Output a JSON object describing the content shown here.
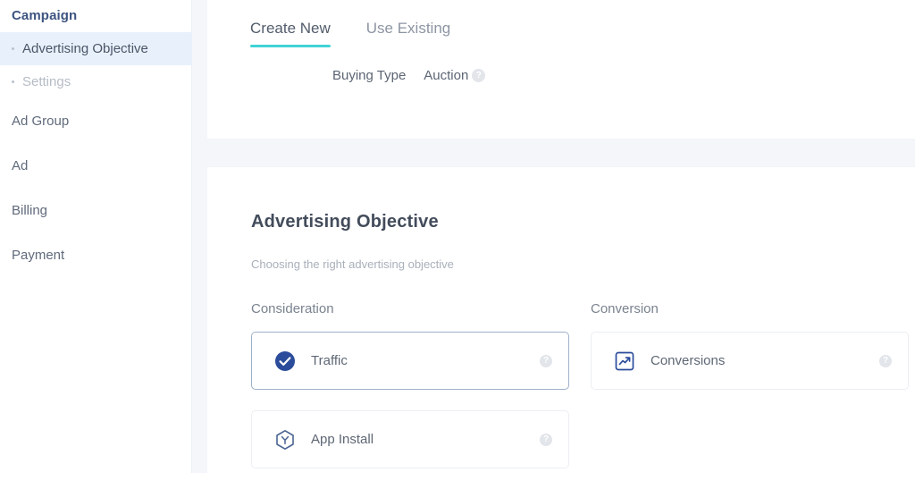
{
  "sidebar": {
    "section_title": "Campaign",
    "items": [
      {
        "label": "Advertising Objective",
        "state": "active",
        "sub": true,
        "icon": "bullet-icon"
      },
      {
        "label": "Settings",
        "state": "disabled",
        "sub": true,
        "icon": "bullet-icon"
      },
      {
        "label": "Ad Group",
        "state": "default",
        "sub": false
      },
      {
        "label": "Ad",
        "state": "default",
        "sub": false
      },
      {
        "label": "Billing",
        "state": "default",
        "sub": false
      },
      {
        "label": "Payment",
        "state": "default",
        "sub": false
      }
    ]
  },
  "top_panel": {
    "tabs": [
      {
        "label": "Create New",
        "active": true
      },
      {
        "label": "Use Existing",
        "active": false
      }
    ],
    "buying_type": {
      "label": "Buying Type",
      "value": "Auction",
      "help_icon": "question-mark-circle-icon",
      "help_glyph": "?"
    }
  },
  "objective_section": {
    "title": "Advertising Objective",
    "subtitle": "Choosing the right advertising objective",
    "columns": [
      {
        "heading": "Consideration",
        "cards": [
          {
            "label": "Traffic",
            "icon": "check-circle-filled-icon",
            "selected": true,
            "help_glyph": "?"
          },
          {
            "label": "App Install",
            "icon": "hexagon-app-icon",
            "selected": false,
            "help_glyph": "?"
          }
        ]
      },
      {
        "heading": "Conversion",
        "cards": [
          {
            "label": "Conversions",
            "icon": "trending-up-square-icon",
            "selected": false,
            "help_glyph": "?"
          }
        ]
      }
    ]
  },
  "colors": {
    "accent_teal": "#40d3d6",
    "brand_navy": "#3d5480",
    "selected_icon_blue": "#2b4c9b",
    "active_nav_bg": "#e8f1fb",
    "page_bg": "#f4f6f9",
    "panel_bg": "#ffffff",
    "card_border": "#eceef2",
    "card_border_selected": "#9fb0c9",
    "help_icon_bg": "#e2e5ea"
  }
}
